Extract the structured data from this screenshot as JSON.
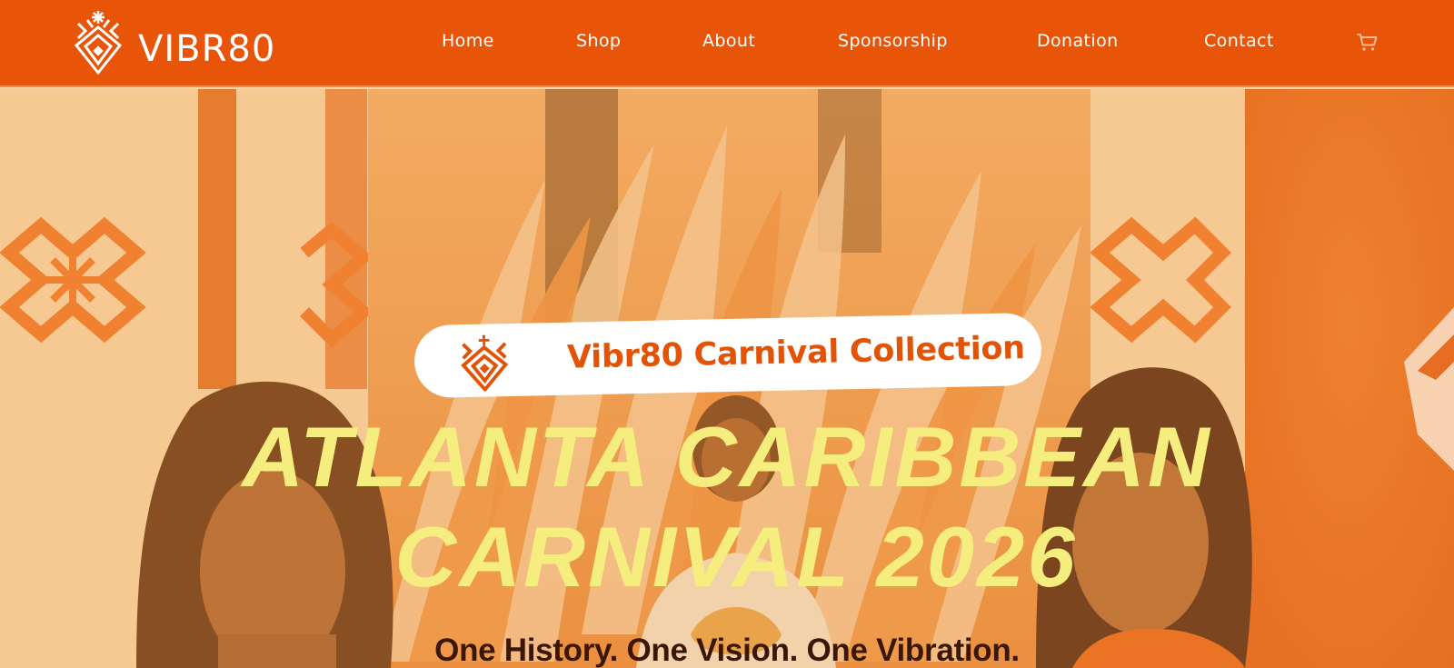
{
  "brand": {
    "name": "VIBR80",
    "colors": {
      "primary": "#e85408",
      "headline": "#f5ee7e",
      "badge_text": "#e35306"
    }
  },
  "nav": {
    "items": [
      {
        "label": "Home"
      },
      {
        "label": "Shop"
      },
      {
        "label": "About"
      },
      {
        "label": "Sponsorship"
      },
      {
        "label": "Donation"
      },
      {
        "label": "Contact"
      }
    ],
    "cart_icon": "cart-icon"
  },
  "hero": {
    "badge_text": "Vibr80 Carnival Collection",
    "headline_line1": "ATLANTA CARIBBEAN",
    "headline_line2": "CARNIVAL 2026",
    "tagline": "One History. One Vision. One Vibration."
  }
}
